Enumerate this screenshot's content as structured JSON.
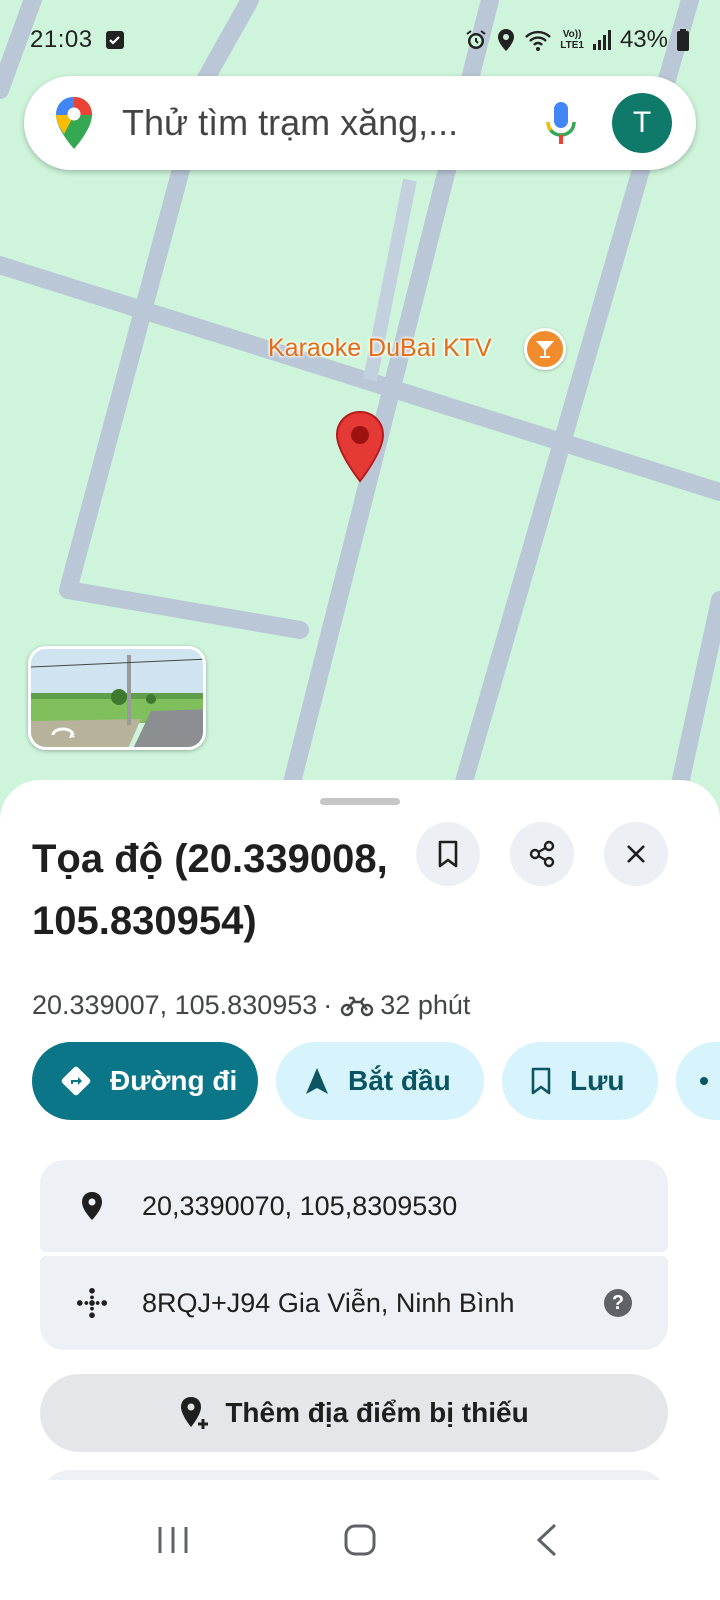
{
  "status_bar": {
    "time": "21:03",
    "battery": "43%",
    "network": "LTE1",
    "icons": [
      "check-notification-icon",
      "alarm-icon",
      "location-icon",
      "wifi-icon",
      "volte-icon",
      "signal-icon",
      "battery-icon"
    ]
  },
  "search": {
    "placeholder": "Thử tìm trạm xăng,...",
    "avatar_letter": "T"
  },
  "map": {
    "poi_label": "Karaoke DuBai KTV",
    "poi_icon": "cocktail-icon",
    "pin_color": "#e53935",
    "land_color": "#cef5db",
    "road_color": "#b8c6d6"
  },
  "place": {
    "title": "Tọa độ (20.339008, 105.830954)",
    "coords_short": "20.339007, 105.830953",
    "separator": "·",
    "travel_time": "32 phút"
  },
  "actions": {
    "directions": "Đường đi",
    "start": "Bắt đầu",
    "save": "Lưu"
  },
  "details": {
    "coordinates": "20,3390070, 105,8309530",
    "plus_code": "8RQJ+J94 Gia Viễn, Ninh Bình",
    "help": "?"
  },
  "add_missing_place": "Thêm địa điểm bị thiếu",
  "colors": {
    "accent": "#0a7688",
    "chip_bg": "#d7f3fb",
    "avatar": "#0f7a6a"
  }
}
